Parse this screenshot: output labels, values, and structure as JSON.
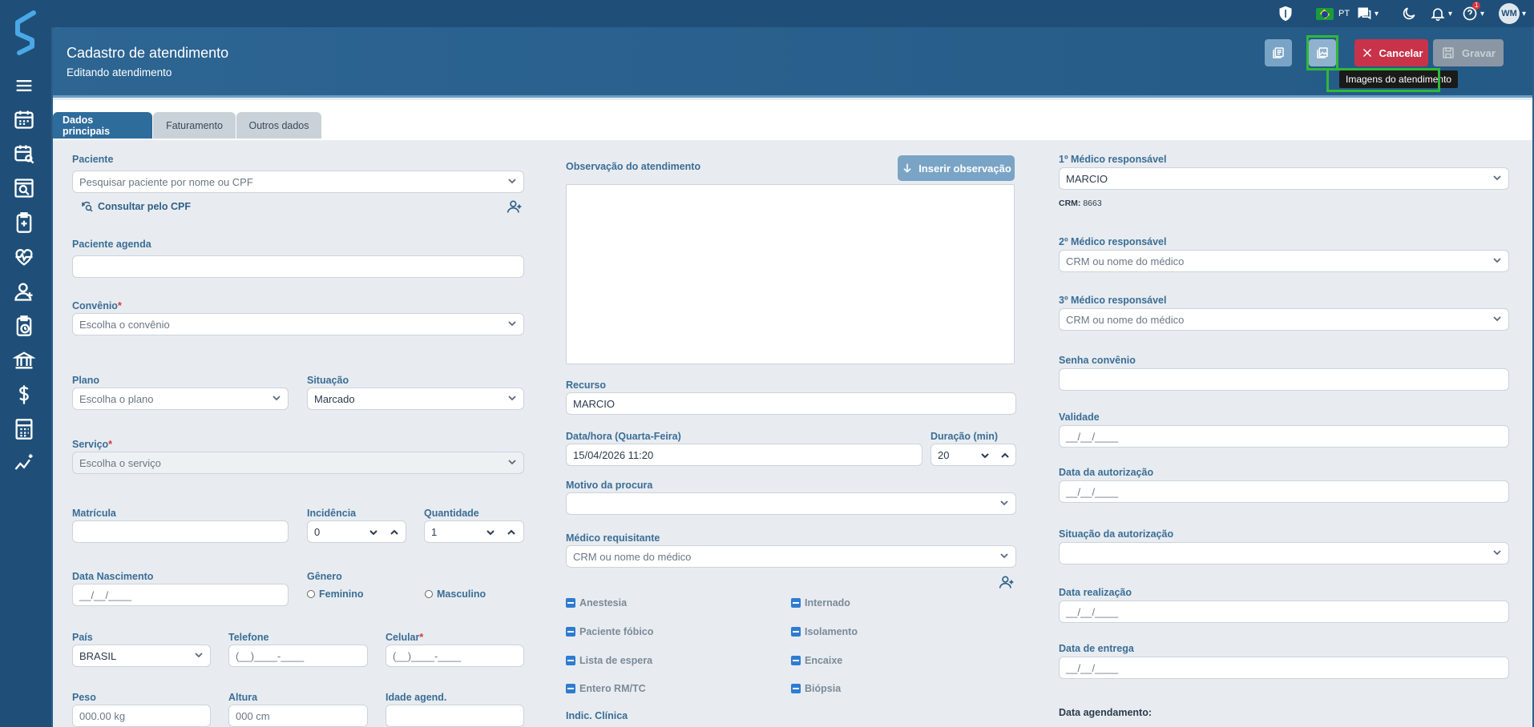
{
  "topbar": {
    "language": "PT",
    "avatar_initials": "WM",
    "notification_count": "1",
    "icons": [
      "shield-icon",
      "brazil-flag-icon",
      "chat-icon",
      "moon-icon",
      "bell-icon",
      "help-icon"
    ]
  },
  "sidebar": {
    "icons": [
      "logo-icon",
      "menu-icon",
      "calendar-icon",
      "calendar-search-icon",
      "search-window-icon",
      "clipboard-medical-icon",
      "heart-pulse-icon",
      "user-add-icon",
      "clipboard-clock-icon",
      "bank-icon",
      "dollar-icon",
      "calculator-icon",
      "chart-sparkle-icon"
    ]
  },
  "header": {
    "title": "Cadastro de atendimento",
    "subtitle": "Editando atendimento",
    "cancel_label": "Cancelar",
    "save_label": "Gravar",
    "tooltip": "Imagens do atendimento"
  },
  "tabs": [
    {
      "label": "Dados principais",
      "active": true
    },
    {
      "label": "Faturamento",
      "active": false
    },
    {
      "label": "Outros dados",
      "active": false
    }
  ],
  "left": {
    "paciente_label": "Paciente",
    "paciente_placeholder": "Pesquisar paciente por nome ou CPF",
    "consultar_cpf": "Consultar pelo CPF",
    "paciente_agenda_label": "Paciente agenda",
    "convenio_label": "Convênio",
    "convenio_placeholder": "Escolha o convênio",
    "plano_label": "Plano",
    "plano_placeholder": "Escolha o plano",
    "situacao_label": "Situação",
    "situacao_value": "Marcado",
    "servico_label": "Serviço",
    "servico_placeholder": "Escolha o serviço",
    "matricula_label": "Matrícula",
    "incidencia_label": "Incidência",
    "incidencia_value": "0",
    "quantidade_label": "Quantidade",
    "quantidade_value": "1",
    "nascimento_label": "Data Nascimento",
    "nascimento_placeholder": "__/__/____",
    "genero_label": "Gênero",
    "genero_feminino": "Feminino",
    "genero_masculino": "Masculino",
    "pais_label": "País",
    "pais_value": "BRASIL",
    "telefone_label": "Telefone",
    "telefone_placeholder": "(__)____-____",
    "celular_label": "Celular",
    "celular_placeholder": "(__)____-____",
    "peso_label": "Peso",
    "peso_placeholder": "000.00 kg",
    "altura_label": "Altura",
    "altura_placeholder": "000 cm",
    "idade_label": "Idade agend."
  },
  "middle": {
    "obs_label": "Observação do atendimento",
    "inserir_obs": "Inserir observação",
    "recurso_label": "Recurso",
    "recurso_value": "MARCIO",
    "datahora_label": "Data/hora (Quarta-Feira)",
    "datahora_value": "15/04/2026 11:20",
    "duracao_label": "Duração (min)",
    "duracao_value": "20",
    "motivo_label": "Motivo da procura",
    "medico_req_label": "Médico requisitante",
    "medico_req_placeholder": "CRM ou nome do médico",
    "checks_left": [
      "Anestesia",
      "Paciente fóbico",
      "Lista de espera",
      "Entero RM/TC"
    ],
    "checks_right": [
      "Internado",
      "Isolamento",
      "Encaixe",
      "Biópsia"
    ],
    "indic_label": "Indic. Clínica"
  },
  "right": {
    "medico1_label": "1º Médico responsável",
    "medico1_value": "MARCIO",
    "crm_label": "CRM:",
    "crm_value": "8663",
    "medico2_label": "2º Médico responsável",
    "medico2_placeholder": "CRM ou nome do médico",
    "medico3_label": "3º Médico responsável",
    "medico3_placeholder": "CRM ou nome do médico",
    "senha_label": "Senha convênio",
    "validade_label": "Validade",
    "validade_placeholder": "__/__/____",
    "data_aut_label": "Data da autorização",
    "data_aut_placeholder": "__/__/____",
    "situacao_aut_label": "Situação da autorização",
    "data_real_label": "Data realização",
    "data_real_placeholder": "__/__/____",
    "data_entrega_label": "Data de entrega",
    "data_entrega_placeholder": "__/__/____",
    "data_agend_label": "Data agendamento:"
  }
}
